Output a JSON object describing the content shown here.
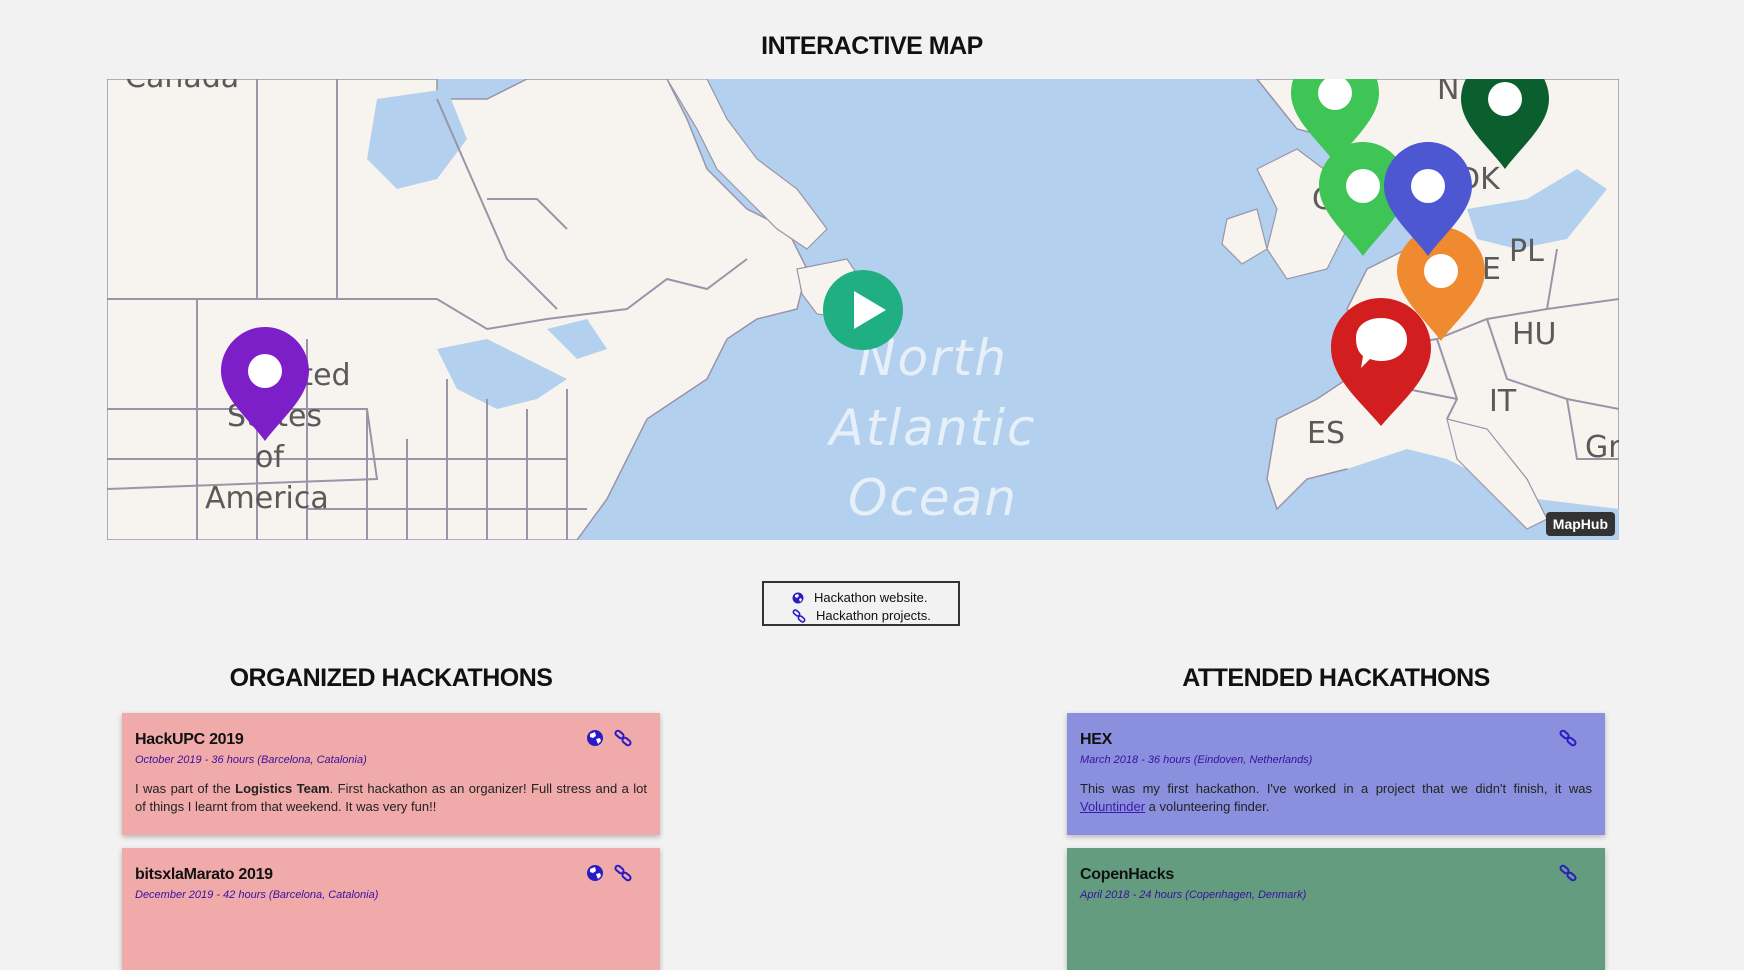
{
  "map_section": {
    "title": "INTERACTIVE MAP",
    "attribution": "MapHub",
    "labels": {
      "canada": "Canada",
      "usa": [
        "United",
        "States",
        "of",
        "America"
      ],
      "ocean": [
        "North",
        "Atlantic",
        "Ocean"
      ],
      "countries": [
        "PL",
        "HU",
        "IT",
        "ES",
        "Gr",
        "N",
        "DK",
        "E",
        "C"
      ]
    },
    "pins": [
      {
        "color": "#7d1fc9",
        "icon": "dot"
      },
      {
        "color": "#3ec556",
        "icon": "dot"
      },
      {
        "color": "#3ec556",
        "icon": "dot"
      },
      {
        "color": "#0b5f2e",
        "icon": "dot"
      },
      {
        "color": "#4d57d2",
        "icon": "dot"
      },
      {
        "color": "#f08a30",
        "icon": "dot"
      },
      {
        "color": "#d21e1e",
        "icon": "speech-bubble"
      }
    ]
  },
  "legend": {
    "website": "Hackathon website.",
    "projects": "Hackathon projects."
  },
  "organized": {
    "title": "ORGANIZED HACKATHONS",
    "cards": [
      {
        "name": "HackUPC 2019",
        "meta": "October 2019 - 36 hours (Barcelona, Catalonia)",
        "desc_pre": "I was part of the ",
        "desc_bold": "Logistics Team",
        "desc_post": ". First hackathon as an organizer! Full stress and a lot of things I learnt from that weekend. It was very fun!!"
      },
      {
        "name": "bitsxlaMarato 2019",
        "meta": "December 2019 - 42 hours (Barcelona, Catalonia)"
      }
    ]
  },
  "attended": {
    "title": "ATTENDED HACKATHONS",
    "cards": [
      {
        "name": "HEX",
        "meta": "March 2018 - 36 hours (Eindoven, Netherlands)",
        "desc_pre": "This was my first hackathon. I've worked in a project that we didn't finish, it was ",
        "desc_link": "Voluntinder",
        "desc_post": " a volunteering finder."
      },
      {
        "name": "CopenHacks",
        "meta": "April 2018 - 24 hours (Copenhagen, Denmark)"
      }
    ]
  },
  "colors": {
    "icon": "#2a1bc4",
    "organized_card": "#f0aaa9",
    "attended_card_1": "#8a90dd",
    "attended_card_2": "#649c80",
    "play": "#1faf82"
  }
}
